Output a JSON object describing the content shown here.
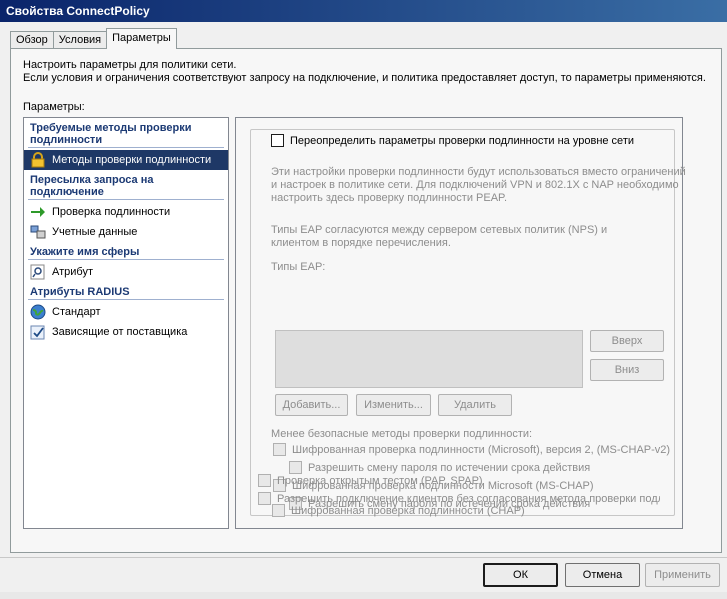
{
  "window": {
    "title": "Свойства ConnectPolicy"
  },
  "tabs": [
    {
      "label": "Обзор"
    },
    {
      "label": "Условия"
    },
    {
      "label": "Параметры"
    }
  ],
  "description": {
    "line1": "Настроить параметры для политики сети.",
    "line2": "Если условия и ограничения соответствуют запросу на подключение, и политика предоставляет доступ, то параметры применяются."
  },
  "params_label": "Параметры:",
  "sidebar": {
    "cat1": "Требуемые методы проверки подлинности",
    "item_auth_methods": "Методы проверки подлинности",
    "cat2": "Пересылка запроса на подключение",
    "item_auth": "Проверка подлинности",
    "item_accounting": "Учетные данные",
    "cat3": "Укажите имя сферы",
    "item_attribute": "Атрибут",
    "cat4": "Атрибуты RADIUS",
    "item_standard": "Стандарт",
    "item_vendor": "Зависящие от поставщика"
  },
  "main": {
    "override_label": "Переопределить параметры проверки подлинности на уровне сети",
    "info_text": "Эти настройки проверки подлинности будут использоваться вместо ограничений и настроек в политике сети. Для подключений VPN и 802.1X с NAP необходимо настроить здесь проверку подлинности PEAP.",
    "eap_negotiation": "Типы EAP согласуются между сервером сетевых политик (NPS) и клиентом в порядке перечисления.",
    "eap_types_label": "Типы EAP:",
    "up_button": "Вверх",
    "down_button": "Вниз",
    "add_button": "Добавить...",
    "edit_button": "Изменить...",
    "remove_button": "Удалить",
    "less_secure_label": "Менее безопасные методы проверки подлинности:",
    "mschapv2": "Шифрованная проверка подлинности (Microsoft), версия 2, (MS-CHAP-v2)",
    "mschapv2_pwd": "Разрешить смену пароля по истечении срока действия",
    "mschap": "Шифрованная проверка подлинности Microsoft (MS-CHAP)",
    "mschap_pwd": "Разрешить смену пароля по истечении срока действия",
    "chap": "Шифрованная проверка подлинности (CHAP)",
    "pap": "Проверка открытым тестом (PAP, SPAP)",
    "unauth": "Разрешить подключение клиентов без согласования метода проверки подли"
  },
  "footer": {
    "ok": "ОК",
    "cancel": "Отмена",
    "apply": "Применить"
  },
  "colors": {
    "selected_bg": "#1e3866",
    "category_text": "#1c3a74",
    "disabled_text": "#8d8d8d"
  }
}
